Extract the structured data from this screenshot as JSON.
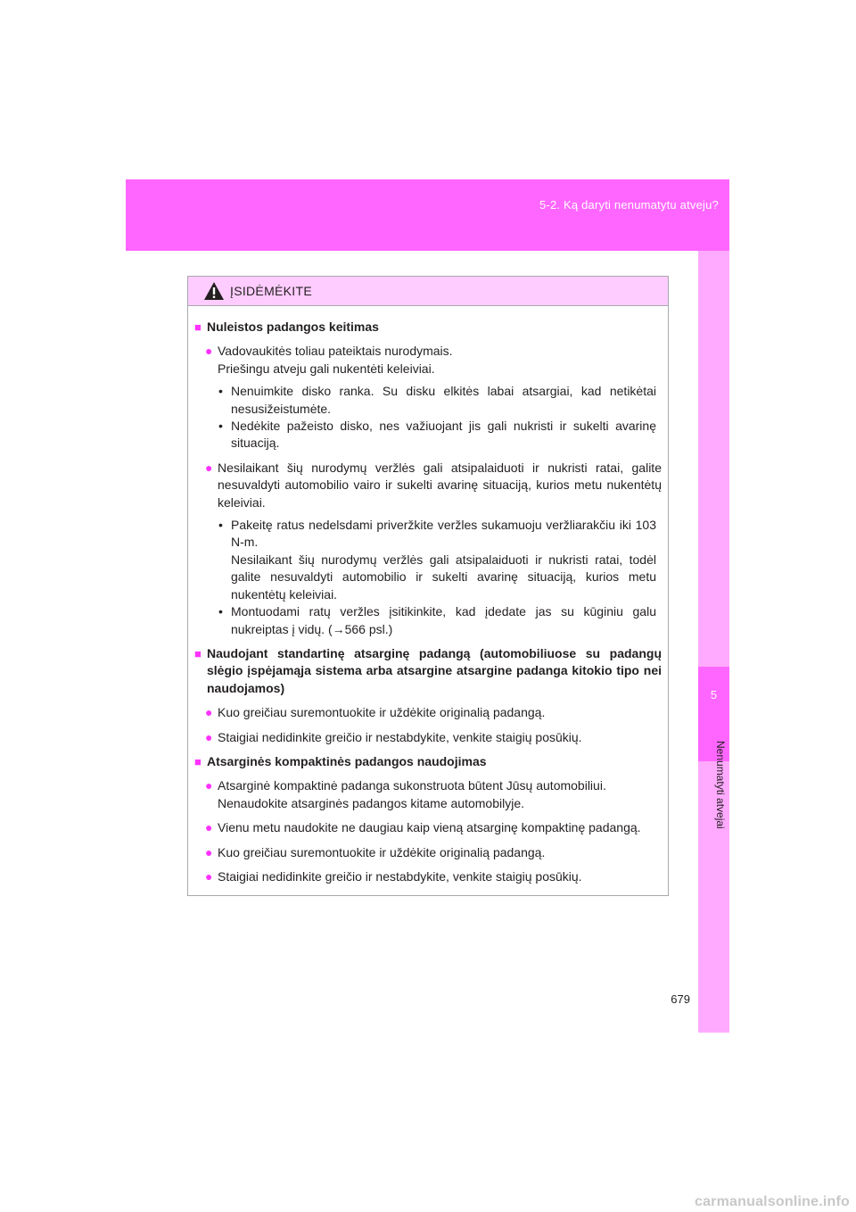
{
  "header": {
    "section_title": "5-2. Ką daryti nenumatytu atveju?",
    "chapter_number": "5",
    "chapter_title": "Nenumatyti atvejai"
  },
  "page_number": "679",
  "caution": {
    "title": "ĮSIDĖMĖKITE",
    "icon": "warning-triangle-icon",
    "sections": [
      {
        "heading": "Nuleistos padangos keitimas",
        "bullets": [
          {
            "text": "Vadovaukitės toliau pateiktais nurodymais.",
            "text2": "Priešingu atveju gali nukentėti keleiviai.",
            "subitems": [
              {
                "text": "Nenuimkite disko ranka. Su disku elkitės labai atsargiai, kad netikėtai nesusižeistumėte."
              },
              {
                "text": "Nedėkite pažeisto disko, nes važiuojant jis gali nukristi ir sukelti avarinę situaciją."
              }
            ]
          },
          {
            "text": "Nesilaikant šių nurodymų veržlės gali atsipalaiduoti ir nukristi ratai, galite nesuvaldyti automobilio vairo ir sukelti avarinę situaciją, kurios metu nukentėtų keleiviai.",
            "subitems": [
              {
                "text": "Pakeitę ratus nedelsdami priveržkite veržles sukamuoju veržliarakčiu iki 103 N-m.",
                "text2": "Nesilaikant šių nurodymų veržlės gali atsipalaiduoti ir nukristi ratai, todėl galite nesuvaldyti automobilio ir sukelti avarinę situaciją, kurios metu nukentėtų keleiviai."
              },
              {
                "text": "Montuodami ratų veržles įsitikinkite, kad įdedate jas su kūginiu galu nukreiptas į vidų. (→566 psl.)"
              }
            ]
          }
        ]
      },
      {
        "heading": "Naudojant standartinę atsarginę padangą (automobiliuose su padangų slėgio įspėjamąja sistema arba atsargine atsargine padanga kitokio tipo nei naudojamos)",
        "bullets": [
          {
            "text": "Kuo greičiau suremontuokite ir uždėkite originalią padangą."
          },
          {
            "text": "Staigiai nedidinkite greičio ir nestabdykite, venkite staigių posūkių."
          }
        ]
      },
      {
        "heading": "Atsarginės kompaktinės padangos naudojimas",
        "bullets": [
          {
            "text": "Atsarginė kompaktinė padanga sukonstruota būtent Jūsų automobiliui.",
            "text2": "Nenaudokite atsarginės padangos kitame automobilyje."
          },
          {
            "text": "Vienu metu naudokite ne daugiau kaip vieną atsarginę kompaktinę padangą."
          },
          {
            "text": "Kuo greičiau suremontuokite ir uždėkite originalią padangą."
          },
          {
            "text": "Staigiai nedidinkite greičio ir nestabdykite, venkite staigių posūkių."
          }
        ]
      }
    ]
  },
  "watermark": "carmanualsonline.info",
  "colors": {
    "accent": "#ff66ff",
    "light_accent": "#ffaaff",
    "caution_header": "#ffccff"
  }
}
